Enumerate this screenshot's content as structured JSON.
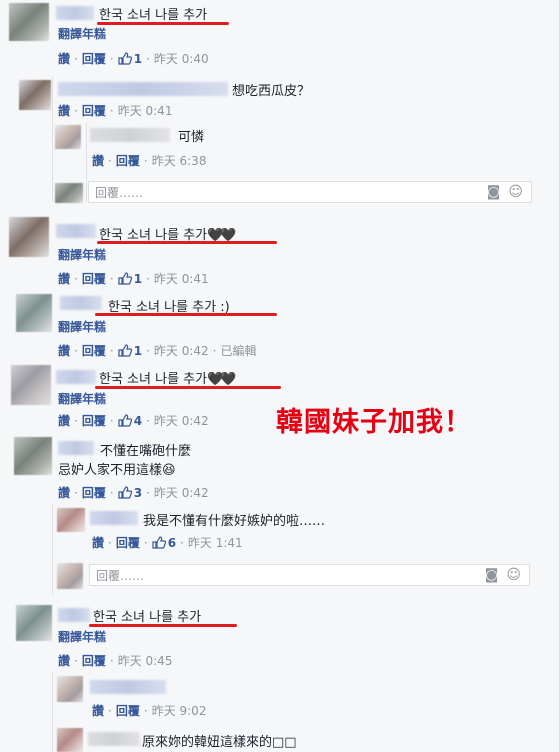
{
  "labels": {
    "translate": "翻譯年糕",
    "like": "讚",
    "reply": "回覆",
    "reply_placeholder": "回覆……",
    "edited": "已編輯",
    "camera_icon": "camera-icon",
    "smiley_icon": "smiley-icon",
    "thumb_icon": "thumbs-up-icon"
  },
  "comments": [
    {
      "text": "한국 소녀 나를 추가",
      "likes": "1",
      "time": "昨天 0:40"
    },
    {
      "text": "想吃西瓜皮？",
      "time": "昨天 0:41"
    },
    {
      "text": "可憐",
      "time": "昨天 6:38"
    },
    {
      "text": "한국 소녀 나를 추가",
      "hearts": "🖤🖤",
      "likes": "1",
      "time": "昨天 0:41"
    },
    {
      "text": "한국 소녀 나를 추가 :)",
      "likes": "1",
      "time": "昨天 0:42"
    },
    {
      "text": "한국 소녀 나를 추가",
      "hearts": "🖤🖤",
      "likes": "4",
      "time": "昨天 0:42"
    },
    {
      "text": "不懂在嘴砲什麼",
      "text2": "忌妒人家不用這樣😆",
      "likes": "3",
      "time": "昨天 0:42"
    },
    {
      "text": "我是不懂有什麼好嫉妒的啦……",
      "likes": "6",
      "time": "昨天 1:41"
    },
    {
      "text": "한국 소녀 나를 추가",
      "time": "昨天 0:45"
    },
    {
      "time": "昨天 9:02"
    },
    {
      "text": "原來妳的韓妞這樣來的□□"
    }
  ],
  "annotation": "韓國妹子加我！",
  "colors": {
    "link": "#365899",
    "underline": "#e21b23",
    "annotation": "#e60012",
    "background": "#f6f7f9"
  }
}
